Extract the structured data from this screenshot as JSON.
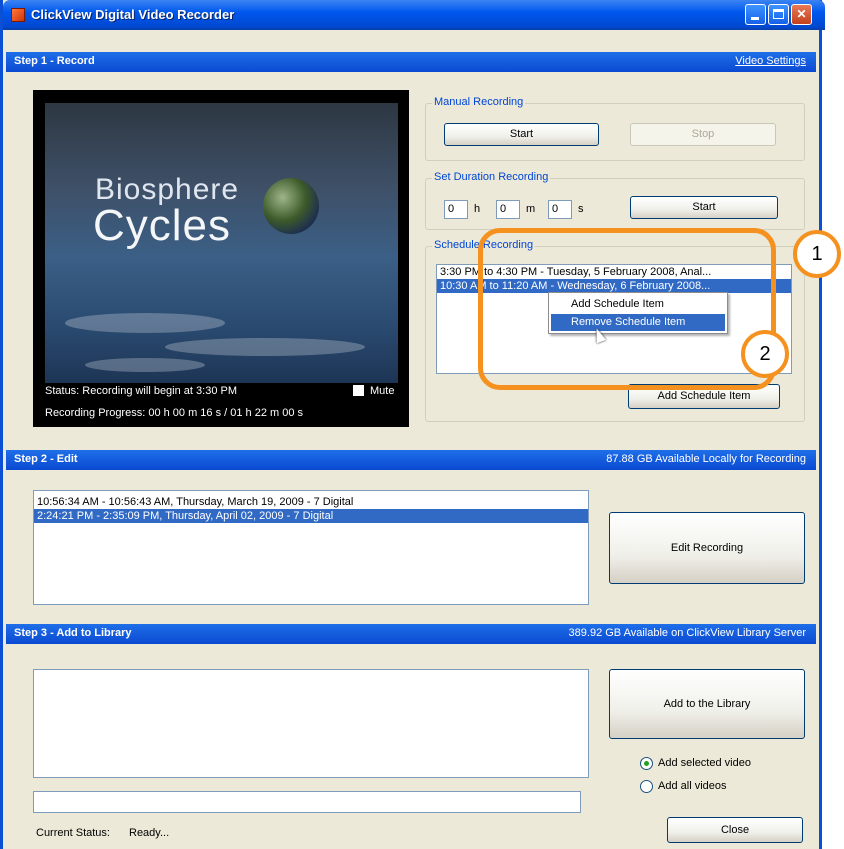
{
  "window": {
    "title": "ClickView Digital Video Recorder"
  },
  "step1": {
    "title": "Step 1 - Record",
    "settings_link": "Video Settings",
    "video": {
      "title_line1": "Biosphere",
      "title_line2": "Cycles",
      "status": "Status: Recording will begin at 3:30 PM",
      "mute_label": "Mute",
      "progress": "Recording Progress: 00 h 00 m 16 s / 01 h 22 m 00 s"
    },
    "manual": {
      "label": "Manual Recording",
      "start": "Start",
      "stop": "Stop"
    },
    "duration": {
      "label": "Set Duration Recording",
      "hours": "0",
      "h": "h",
      "minutes": "0",
      "m": "m",
      "seconds": "0",
      "s": "s",
      "start": "Start"
    },
    "schedule": {
      "label": "Schedule Recording",
      "items": [
        "3:30 PM to 4:30 PM - Tuesday, 5 February 2008, Anal...",
        "10:30 AM to 11:20 AM - Wednesday, 6 February 2008..."
      ],
      "context_menu": [
        "Add Schedule Item",
        "Remove Schedule Item"
      ],
      "add_button": "Add Schedule Item"
    }
  },
  "step2": {
    "title": "Step 2 - Edit",
    "available": "87.88 GB Available Locally for Recording",
    "recordings": [
      "10:56:34 AM - 10:56:43 AM, Thursday, March 19, 2009 - 7 Digital",
      "2:24:21 PM - 2:35:09 PM, Thursday, April 02, 2009 - 7 Digital"
    ],
    "edit_button": "Edit Recording"
  },
  "step3": {
    "title": "Step 3 - Add to Library",
    "available": "389.92 GB Available on ClickView Library Server",
    "add_button": "Add to the Library",
    "radio_selected": "Add selected video",
    "radio_all": "Add all videos",
    "current_status_label": "Current Status:",
    "current_status_value": "Ready...",
    "close_button": "Close"
  },
  "callouts": [
    "1",
    "2"
  ],
  "colors": {
    "accent": "#0a49d2",
    "callout": "#f5911f",
    "selection": "#316ac5"
  }
}
